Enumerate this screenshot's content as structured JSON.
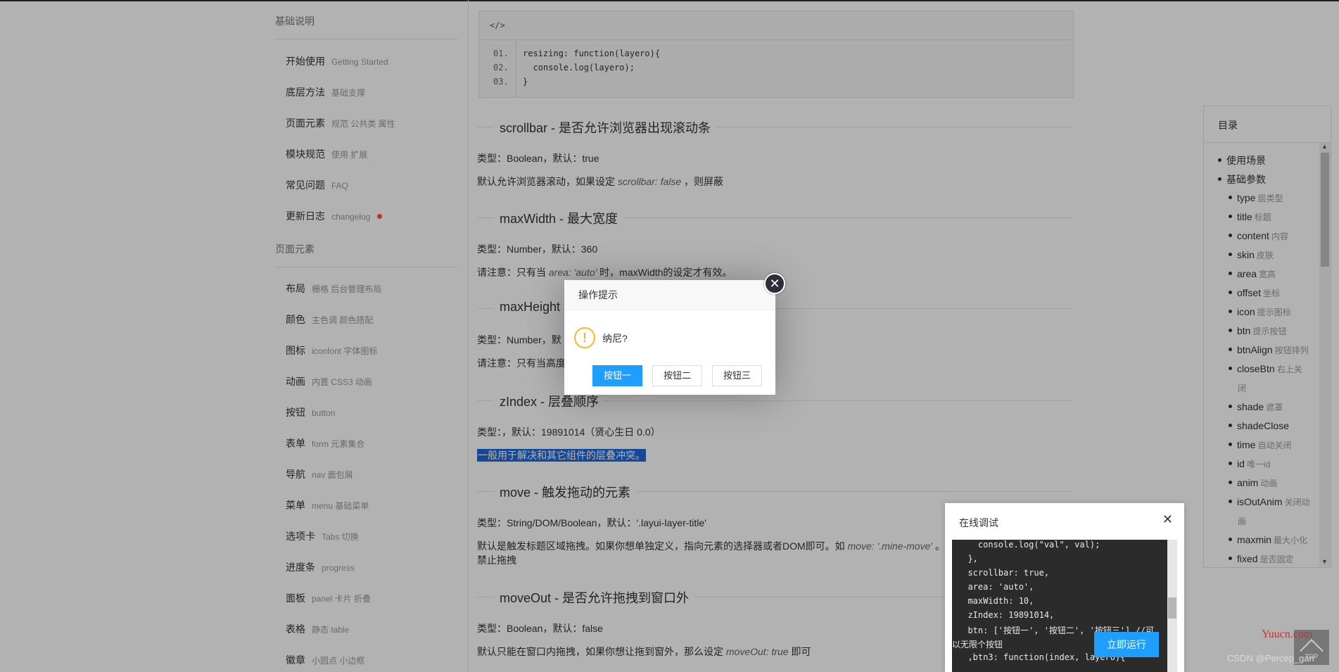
{
  "sidebar": {
    "group1_title": "基础说明",
    "items1": [
      {
        "zh": "开始使用",
        "en": "Getting Started"
      },
      {
        "zh": "底层方法",
        "en": "基础支撑"
      },
      {
        "zh": "页面元素",
        "en": "规范 公共类 属性"
      },
      {
        "zh": "模块规范",
        "en": "使用 扩展"
      },
      {
        "zh": "常见问题",
        "en": "FAQ"
      },
      {
        "zh": "更新日志",
        "en": "changelog"
      }
    ],
    "group2_title": "页面元素",
    "items2": [
      {
        "zh": "布局",
        "en": "栅格 后台管理布局"
      },
      {
        "zh": "颜色",
        "en": "主色调 颜色搭配"
      },
      {
        "zh": "图标",
        "en": "iconfont 字体图标"
      },
      {
        "zh": "动画",
        "en": "内置 CSS3 动画"
      },
      {
        "zh": "按钮",
        "en": "button"
      },
      {
        "zh": "表单",
        "en": "form 元素集合"
      },
      {
        "zh": "导航",
        "en": "nav 面包屑"
      },
      {
        "zh": "菜单",
        "en": "menu 基础菜单"
      },
      {
        "zh": "选项卡",
        "en": "Tabs 切换"
      },
      {
        "zh": "进度条",
        "en": "progress"
      },
      {
        "zh": "面板",
        "en": "panel 卡片 折叠"
      },
      {
        "zh": "表格",
        "en": "静态 table"
      },
      {
        "zh": "徽章",
        "en": "小圆点 小边框"
      }
    ]
  },
  "code": {
    "head": "</>",
    "lines": [
      {
        "num": "01.",
        "text": "resizing: function(layero){"
      },
      {
        "num": "02.",
        "text": "  console.log(layero);"
      },
      {
        "num": "03.",
        "text": "}"
      }
    ]
  },
  "sections": {
    "scrollbar": {
      "title": "scrollbar - 是否允许浏览器出现滚动条",
      "type": "类型：Boolean，默认：true",
      "desc_a": "默认允许浏览器滚动，如果设定 ",
      "desc_i": "scrollbar: false",
      "desc_b": " ，则屏蔽"
    },
    "maxwidth": {
      "title": "maxWidth - 最大宽度",
      "type": "类型：Number，默认：360",
      "desc_a": "请注意：只有当 ",
      "desc_i": "area: 'auto'",
      "desc_b": " 时，maxWidth的设定才有效。"
    },
    "maxheight": {
      "title": "maxHeight",
      "type": "类型：Number，默",
      "desc": "请注意：只有当高度"
    },
    "zindex": {
      "title": "zIndex - 层叠顺序",
      "type": "类型：，默认：19891014（贤心生日 0.0）",
      "desc": "一般用于解决和其它组件的层叠冲突。"
    },
    "move": {
      "title": "move - 触发拖动的元素",
      "type": "类型：String/DOM/Boolean，默认：'.layui-layer-title'",
      "desc_a": "默认是触发标题区域拖拽。如果你想单独定义，指向元素的选择器或者DOM即可。如 ",
      "desc_i": "move: '.mine-move'",
      "desc_b": " 。你",
      "desc2": "禁止拖拽"
    },
    "moveout": {
      "title": "moveOut - 是否允许拖拽到窗口外",
      "type": "类型：Boolean，默认：false",
      "desc_a": "默认只能在窗口内拖拽，如果你想让拖到窗外，那么设定 ",
      "desc_i": "moveOut: true",
      "desc_b": " 即可"
    }
  },
  "toc": {
    "title": "目录",
    "items": [
      {
        "name": "使用场景",
        "sub": "",
        "level": 1
      },
      {
        "name": "基础参数",
        "sub": "",
        "level": 1
      },
      {
        "name": "type",
        "sub": "层类型",
        "level": 2
      },
      {
        "name": "title",
        "sub": "标题",
        "level": 2
      },
      {
        "name": "content",
        "sub": "内容",
        "level": 2
      },
      {
        "name": "skin",
        "sub": "皮肤",
        "level": 2
      },
      {
        "name": "area",
        "sub": "宽高",
        "level": 2
      },
      {
        "name": "offset",
        "sub": "坐标",
        "level": 2
      },
      {
        "name": "icon",
        "sub": "提示图标",
        "level": 2
      },
      {
        "name": "btn",
        "sub": "提示按钮",
        "level": 2
      },
      {
        "name": "btnAlign",
        "sub": "按钮排列",
        "level": 2
      },
      {
        "name": "closeBtn",
        "sub": "右上关",
        "sub2": "闭",
        "level": 2
      },
      {
        "name": "shade",
        "sub": "遮罩",
        "level": 2
      },
      {
        "name": "shadeClose",
        "sub": "",
        "level": 2
      },
      {
        "name": "time",
        "sub": "自动关闭",
        "level": 2
      },
      {
        "name": "id",
        "sub": "唯一id",
        "level": 2
      },
      {
        "name": "anim",
        "sub": "动画",
        "level": 2
      },
      {
        "name": "isOutAnim",
        "sub": "关闭动",
        "sub2": "画",
        "level": 2
      },
      {
        "name": "maxmin",
        "sub": "最大小化",
        "level": 2
      },
      {
        "name": "fixed",
        "sub": "是否固定",
        "level": 2
      }
    ]
  },
  "dialog": {
    "title": "操作提示",
    "message": "纳尼?",
    "close": "✕",
    "icon": "!",
    "buttons": [
      "按钮一",
      "按钮二",
      "按钮三"
    ]
  },
  "debug": {
    "title": "在线调试",
    "close": "✕",
    "lines": [
      "    console.log(\"val\", val);",
      "  },",
      "  scrollbar: true,",
      "  area: 'auto',",
      "  maxWidth: 10,",
      "  zIndex: 19891014,",
      "  btn: ['按钮一', '按钮二', '按钮三'] //可",
      "以无限个按钮",
      "  ,btn3: function(index, layero){"
    ],
    "run_label": "立即运行"
  },
  "top_button": {
    "label": "TOP"
  },
  "watermark": {
    "site": "Yuucn.com",
    "author": "CSDN @Percep_gan"
  }
}
